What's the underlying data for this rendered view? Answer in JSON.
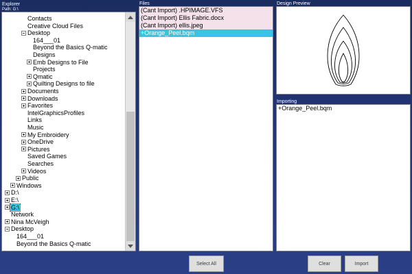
{
  "explorer": {
    "title": "Explorer",
    "path_label": "Path: G:\\",
    "tree": [
      {
        "label": "Contacts",
        "level": 3,
        "expander": "none"
      },
      {
        "label": "Creative Cloud Files",
        "level": 3,
        "expander": "none"
      },
      {
        "label": "Desktop",
        "level": 3,
        "expander": "minus"
      },
      {
        "label": "164___01",
        "level": 4,
        "expander": "none"
      },
      {
        "label": "Beyond the Basics Q-matic",
        "level": 4,
        "expander": "none"
      },
      {
        "label": "Designs",
        "level": 4,
        "expander": "none"
      },
      {
        "label": "Emb Designs to File",
        "level": 4,
        "expander": "plus"
      },
      {
        "label": "Projects",
        "level": 4,
        "expander": "none"
      },
      {
        "label": "Qmatic",
        "level": 4,
        "expander": "plus"
      },
      {
        "label": "Quilting Designs to file",
        "level": 4,
        "expander": "plus"
      },
      {
        "label": "Documents",
        "level": 3,
        "expander": "plus"
      },
      {
        "label": "Downloads",
        "level": 3,
        "expander": "plus"
      },
      {
        "label": "Favorites",
        "level": 3,
        "expander": "plus"
      },
      {
        "label": "IntelGraphicsProfiles",
        "level": 3,
        "expander": "none"
      },
      {
        "label": "Links",
        "level": 3,
        "expander": "none"
      },
      {
        "label": "Music",
        "level": 3,
        "expander": "none"
      },
      {
        "label": "My Embroidery",
        "level": 3,
        "expander": "plus"
      },
      {
        "label": "OneDrive",
        "level": 3,
        "expander": "plus"
      },
      {
        "label": "Pictures",
        "level": 3,
        "expander": "plus"
      },
      {
        "label": "Saved Games",
        "level": 3,
        "expander": "none"
      },
      {
        "label": "Searches",
        "level": 3,
        "expander": "none"
      },
      {
        "label": "Videos",
        "level": 3,
        "expander": "plus"
      },
      {
        "label": "Public",
        "level": 2,
        "expander": "plus"
      },
      {
        "label": "Windows",
        "level": 1,
        "expander": "plus"
      },
      {
        "label": "D:\\",
        "level": 0,
        "expander": "plus"
      },
      {
        "label": "E:\\",
        "level": 0,
        "expander": "plus"
      },
      {
        "label": "G:\\",
        "level": 0,
        "expander": "plus",
        "selected": true
      },
      {
        "label": "Network",
        "level": 0,
        "expander": "none"
      },
      {
        "label": "Nina McVeigh",
        "level": 0,
        "expander": "plus"
      },
      {
        "label": "Desktop",
        "level": 0,
        "expander": "minus"
      },
      {
        "label": "164___01",
        "level": 1,
        "expander": "none"
      },
      {
        "label": "Beyond the Basics Q-matic",
        "level": 1,
        "expander": "none"
      }
    ]
  },
  "files": {
    "title": "Files",
    "items": [
      {
        "label": "(Cant Import) .HPIMAGE.VFS",
        "state": "bad"
      },
      {
        "label": "(Cant Import) Ellis Fabric.docx",
        "state": "bad"
      },
      {
        "label": "(Cant Import) ellis.jpeg",
        "state": "bad"
      },
      {
        "label": "+Orange_Peel.bqm",
        "state": "selected"
      }
    ]
  },
  "preview": {
    "title": "Design Preview",
    "icon": "orange-peel-design-preview"
  },
  "importing": {
    "title": "Importing",
    "items": [
      "+Orange_Peel.bqm"
    ]
  },
  "buttons": {
    "select_all": "Select All",
    "clear": "Clear",
    "import": "Import"
  },
  "colors": {
    "selection": "#39c4e6",
    "cant_import_row": "#f5e1ea",
    "background": "#1f3170"
  }
}
